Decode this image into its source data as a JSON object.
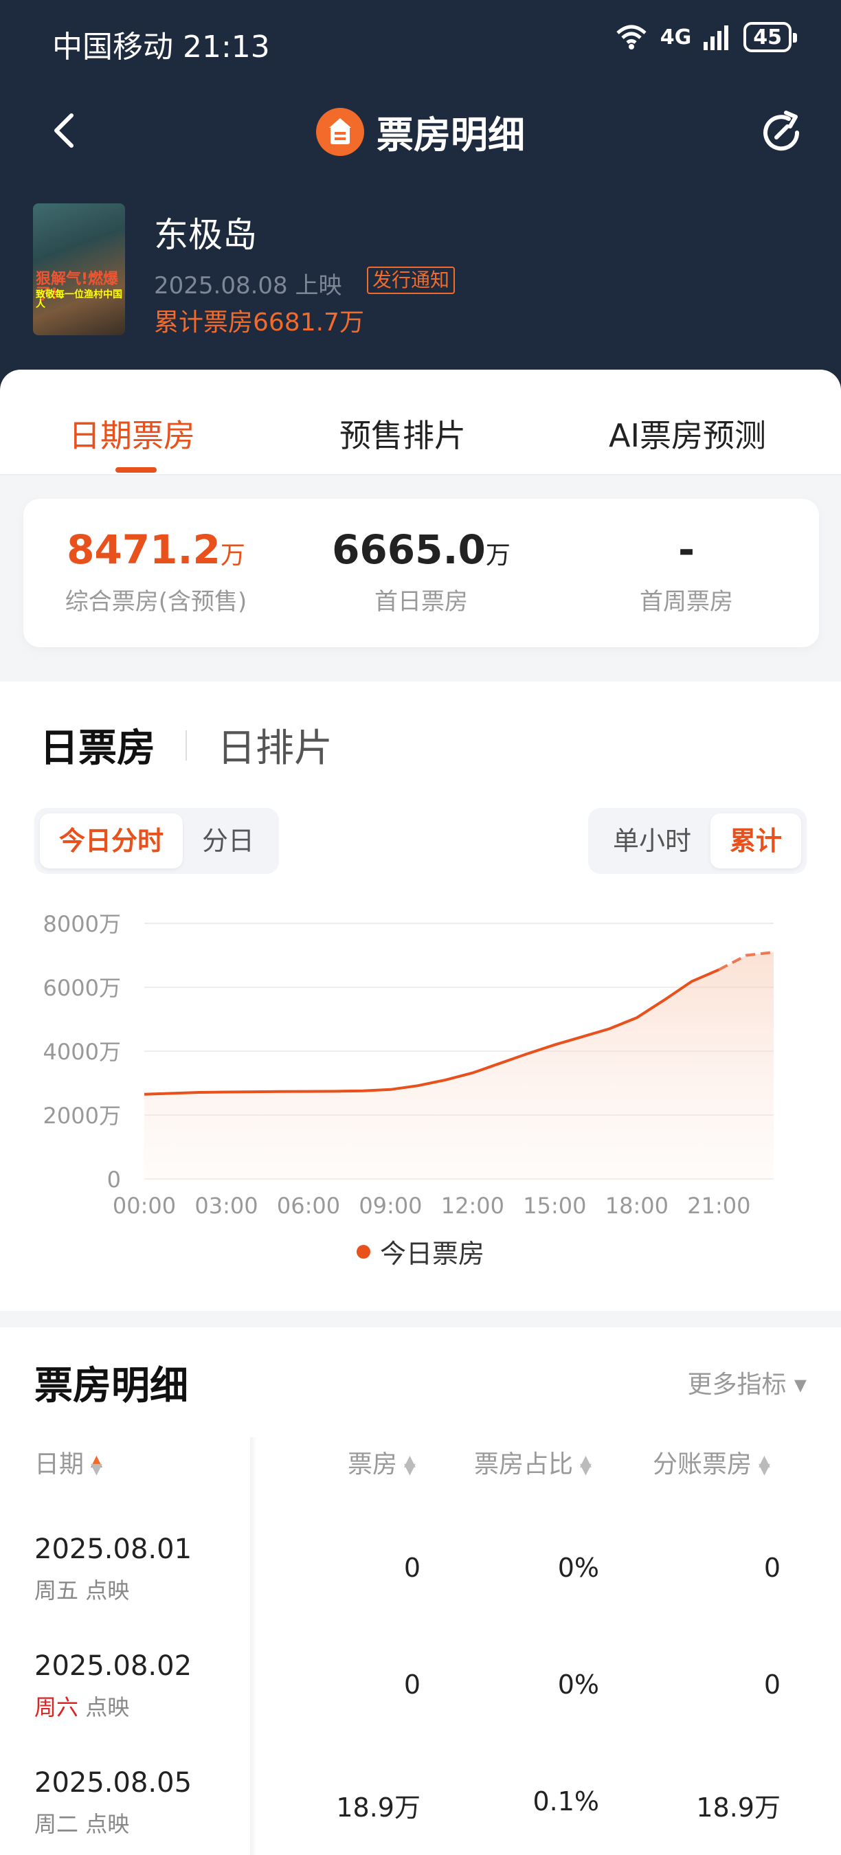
{
  "status_bar": {
    "carrier_time": "中国移动 21:13",
    "network": "4G",
    "battery": "45"
  },
  "nav": {
    "title": "票房明细"
  },
  "movie": {
    "title": "东极岛",
    "release": "2025.08.08 上映",
    "notice_badge": "发行通知",
    "total": "累计票房6681.7万",
    "poster_text_1": "狠解气!燃爆了!",
    "poster_text_2": "致敬每一位渔村中国人"
  },
  "tabs": [
    "日期票房",
    "预售排片",
    "AI票房预测"
  ],
  "summary": [
    {
      "value": "8471.2",
      "unit": "万",
      "label": "综合票房(含预售)"
    },
    {
      "value": "6665.0",
      "unit": "万",
      "label": "首日票房"
    },
    {
      "value": "-",
      "unit": "",
      "label": "首周票房"
    }
  ],
  "chart_section": {
    "sub_tabs": [
      "日票房",
      "日排片"
    ],
    "left_toggle": [
      "今日分时",
      "分日"
    ],
    "right_toggle": [
      "单小时",
      "累计"
    ],
    "legend": "今日票房"
  },
  "chart_data": {
    "type": "line",
    "x": [
      "00:00",
      "01:00",
      "02:00",
      "03:00",
      "04:00",
      "05:00",
      "06:00",
      "07:00",
      "08:00",
      "09:00",
      "10:00",
      "11:00",
      "12:00",
      "13:00",
      "14:00",
      "15:00",
      "16:00",
      "17:00",
      "18:00",
      "19:00",
      "20:00",
      "21:00",
      "22:00",
      "23:00"
    ],
    "series": [
      {
        "name": "今日票房",
        "values": [
          2650,
          2680,
          2710,
          2720,
          2730,
          2735,
          2740,
          2745,
          2760,
          2800,
          2920,
          3100,
          3320,
          3620,
          3920,
          4200,
          4450,
          4700,
          5050,
          5600,
          6180,
          6550,
          7000,
          7100
        ]
      }
    ],
    "projected_from_index": 21,
    "tick_labels_x": [
      "00:00",
      "03:00",
      "06:00",
      "09:00",
      "12:00",
      "15:00",
      "18:00",
      "21:00"
    ],
    "tick_labels_y": [
      "0",
      "2000万",
      "4000万",
      "6000万",
      "8000万"
    ],
    "ylim": [
      0,
      8000
    ],
    "grid": true
  },
  "detail": {
    "title": "票房明细",
    "more": "更多指标 ▾",
    "columns": [
      "日期",
      "票房",
      "票房占比",
      "分账票房"
    ],
    "rows": [
      {
        "date": "2025.08.01",
        "weekday": "周五",
        "tag": "点映",
        "box": "0",
        "ratio": "0%",
        "split": "0"
      },
      {
        "date": "2025.08.02",
        "weekday": "周六",
        "tag": "点映",
        "box": "0",
        "ratio": "0%",
        "split": "0"
      },
      {
        "date": "2025.08.05",
        "weekday": "周二",
        "tag": "点映",
        "box": "18.9万",
        "ratio": "0.1%",
        "split": "18.9万"
      }
    ]
  },
  "colors": {
    "accent": "#e8501c",
    "header_bg": "#1e2a3e"
  }
}
